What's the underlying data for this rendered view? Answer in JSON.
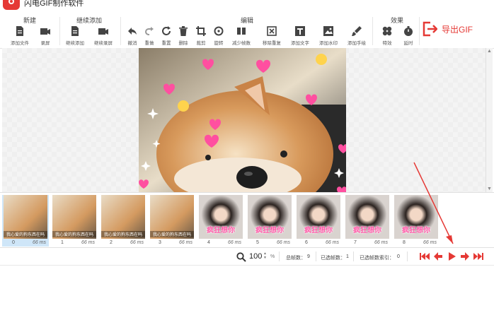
{
  "app": {
    "title": "闪电GIF制作软件"
  },
  "ribbon": {
    "groups": {
      "new": "新建",
      "continue": "继续添加",
      "edit": "编辑",
      "effects": "效果"
    },
    "tools": {
      "add_file": "添加文件",
      "record": "录屏",
      "continue_add": "继续添加",
      "continue_record": "继续录屏",
      "undo": "撤消",
      "redo": "重做",
      "reset": "重置",
      "delete": "删除",
      "crop": "裁剪",
      "rotate": "旋转",
      "reduce_frames": "减少帧数",
      "remove_dup": "移除重复",
      "add_text": "添加文字",
      "add_watermark": "添加水印",
      "add_drawing": "添加手绘",
      "fx": "特效",
      "delay": "延时"
    },
    "export_label": "导出GIF",
    "accent_color": "#e53935"
  },
  "filmstrip": {
    "frames": [
      {
        "index": "0",
        "ms": "66 ms",
        "caption": "我心爱的狗东西在吗"
      },
      {
        "index": "1",
        "ms": "66 ms",
        "caption": "我心爱的狗东西在吗"
      },
      {
        "index": "2",
        "ms": "66 ms",
        "caption": "我心爱的狗东西在吗"
      },
      {
        "index": "3",
        "ms": "66 ms",
        "caption": "我心爱的狗东西在吗"
      },
      {
        "index": "4",
        "ms": "66 ms",
        "caption": "疯狂想你"
      },
      {
        "index": "5",
        "ms": "66 ms",
        "caption": "疯狂想你"
      },
      {
        "index": "6",
        "ms": "66 ms",
        "caption": "疯狂想你"
      },
      {
        "index": "7",
        "ms": "66 ms",
        "caption": "疯狂想你"
      },
      {
        "index": "8",
        "ms": "66 ms",
        "caption": "疯狂想你"
      }
    ],
    "selected_index": "0"
  },
  "status": {
    "zoom_value": "100",
    "zoom_unit": "%",
    "total_frames_label": "总帧数：",
    "total_frames": "9",
    "selected_frames_label": "已选帧数：",
    "selected_frames": "1",
    "selected_index_label": "已选帧数索引：",
    "selected_index": "0"
  },
  "icons": {
    "first": "skip-first-icon",
    "prev": "prev-frame-icon",
    "play": "play-icon",
    "next": "next-frame-icon",
    "last": "skip-last-icon"
  }
}
